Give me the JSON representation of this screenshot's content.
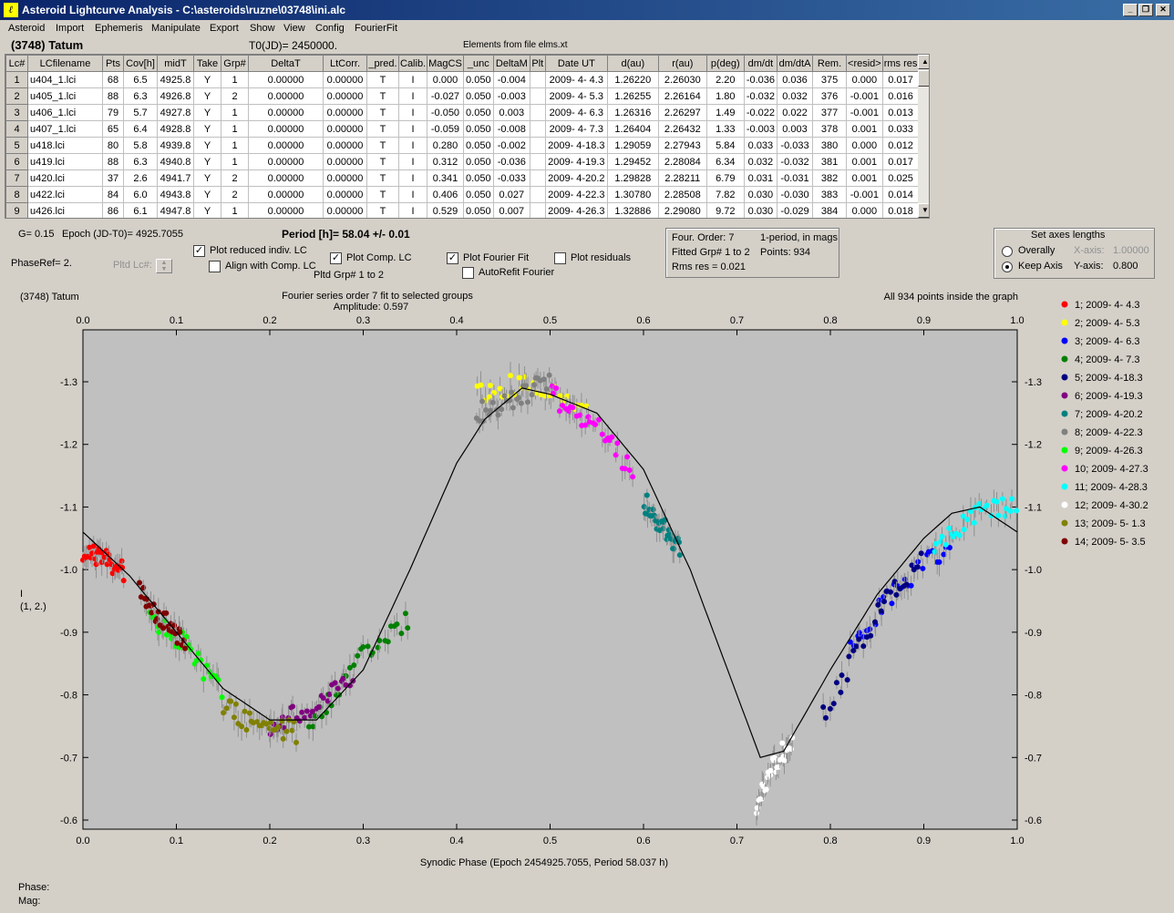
{
  "window": {
    "title": "Asteroid Lightcurve Analysis - C:\\asteroids\\ruzne\\03748\\ini.alc",
    "minimize": "_",
    "maximize": "❐",
    "close": "✕"
  },
  "menu": [
    "Asteroid",
    "Import",
    "Ephemeris",
    "Manipulate",
    "Export",
    "Show",
    "View",
    "Config",
    "FourierFit"
  ],
  "header": {
    "asteroid_name": "(3748) Tatum",
    "t0": "T0(JD)= 2450000.",
    "elements_source": "Elements from file elms.xt"
  },
  "table": {
    "columns": [
      "Lc#",
      "LCfilename",
      "Pts",
      "Cov[h]",
      "midT",
      "Take",
      "Grp#",
      "DeltaT",
      "LtCorr.",
      "_pred.",
      "Calib.",
      "MagCS",
      "_unc",
      "DeltaM",
      "Plt",
      "Date UT",
      "d(au)",
      "r(au)",
      "p(deg)",
      "dm/dt",
      "dm/dtA",
      "Rem.",
      "<resid>",
      "rms res"
    ],
    "rows": [
      [
        "1",
        "u404_1.lci",
        "68",
        "6.5",
        "4925.8",
        "Y",
        "1",
        "0.00000",
        "0.00000",
        "T",
        "I",
        "0.000",
        "0.050",
        "-0.004",
        "",
        "2009- 4- 4.3",
        "1.26220",
        "2.26030",
        "2.20",
        "-0.036",
        "0.036",
        "375",
        "0.000",
        "0.017"
      ],
      [
        "2",
        "u405_1.lci",
        "88",
        "6.3",
        "4926.8",
        "Y",
        "2",
        "0.00000",
        "0.00000",
        "T",
        "I",
        "-0.027",
        "0.050",
        "-0.003",
        "",
        "2009- 4- 5.3",
        "1.26255",
        "2.26164",
        "1.80",
        "-0.032",
        "0.032",
        "376",
        "-0.001",
        "0.016"
      ],
      [
        "3",
        "u406_1.lci",
        "79",
        "5.7",
        "4927.8",
        "Y",
        "1",
        "0.00000",
        "0.00000",
        "T",
        "I",
        "-0.050",
        "0.050",
        "0.003",
        "",
        "2009- 4- 6.3",
        "1.26316",
        "2.26297",
        "1.49",
        "-0.022",
        "0.022",
        "377",
        "-0.001",
        "0.013"
      ],
      [
        "4",
        "u407_1.lci",
        "65",
        "6.4",
        "4928.8",
        "Y",
        "1",
        "0.00000",
        "0.00000",
        "T",
        "I",
        "-0.059",
        "0.050",
        "-0.008",
        "",
        "2009- 4- 7.3",
        "1.26404",
        "2.26432",
        "1.33",
        "-0.003",
        "0.003",
        "378",
        "0.001",
        "0.033"
      ],
      [
        "5",
        "u418.lci",
        "80",
        "5.8",
        "4939.8",
        "Y",
        "1",
        "0.00000",
        "0.00000",
        "T",
        "I",
        "0.280",
        "0.050",
        "-0.002",
        "",
        "2009- 4-18.3",
        "1.29059",
        "2.27943",
        "5.84",
        "0.033",
        "-0.033",
        "380",
        "0.000",
        "0.012"
      ],
      [
        "6",
        "u419.lci",
        "88",
        "6.3",
        "4940.8",
        "Y",
        "1",
        "0.00000",
        "0.00000",
        "T",
        "I",
        "0.312",
        "0.050",
        "-0.036",
        "",
        "2009- 4-19.3",
        "1.29452",
        "2.28084",
        "6.34",
        "0.032",
        "-0.032",
        "381",
        "0.001",
        "0.017"
      ],
      [
        "7",
        "u420.lci",
        "37",
        "2.6",
        "4941.7",
        "Y",
        "2",
        "0.00000",
        "0.00000",
        "T",
        "I",
        "0.341",
        "0.050",
        "-0.033",
        "",
        "2009- 4-20.2",
        "1.29828",
        "2.28211",
        "6.79",
        "0.031",
        "-0.031",
        "382",
        "0.001",
        "0.025"
      ],
      [
        "8",
        "u422.lci",
        "84",
        "6.0",
        "4943.8",
        "Y",
        "2",
        "0.00000",
        "0.00000",
        "T",
        "I",
        "0.406",
        "0.050",
        "0.027",
        "",
        "2009- 4-22.3",
        "1.30780",
        "2.28508",
        "7.82",
        "0.030",
        "-0.030",
        "383",
        "-0.001",
        "0.014"
      ],
      [
        "9",
        "u426.lci",
        "86",
        "6.1",
        "4947.8",
        "Y",
        "1",
        "0.00000",
        "0.00000",
        "T",
        "I",
        "0.529",
        "0.050",
        "0.007",
        "",
        "2009- 4-26.3",
        "1.32886",
        "2.29080",
        "9.72",
        "0.030",
        "-0.029",
        "384",
        "0.000",
        "0.018"
      ]
    ]
  },
  "params": {
    "g": "G= 0.15",
    "epoch": "Epoch (JD-T0)= 4925.7055",
    "period": "Period [h]= 58.04 +/- 0.01",
    "phase_ref": "PhaseRef= 2.",
    "pltd_lc": "Pltd Lc#:",
    "pltd_grp": "Pltd Grp#  1  to   2"
  },
  "checkboxes": {
    "plot_reduced": {
      "label": "Plot reduced indiv. LC",
      "checked": true
    },
    "align_comp": {
      "label": "Align with Comp. LC",
      "checked": false
    },
    "plot_comp": {
      "label": "Plot Comp. LC",
      "checked": true
    },
    "plot_fourier": {
      "label": "Plot Fourier Fit",
      "checked": true
    },
    "autorefit": {
      "label": "AutoRefit Fourier",
      "checked": false
    },
    "plot_residuals": {
      "label": "Plot residuals",
      "checked": false
    }
  },
  "fourier_box": {
    "order": "Four. Order:  7",
    "mode": "1-period, in mags",
    "fitted": "Fitted Grp# 1 to 2",
    "points": "Points: 934",
    "rms": "Rms res      = 0.021"
  },
  "axes_box": {
    "title": "Set axes lengths",
    "overally": "Overally",
    "keep_axis": "Keep Axis",
    "selected": "Keep Axis",
    "xaxis_label": "X-axis:",
    "xaxis_value": "1.00000",
    "yaxis_label": "Y-axis:",
    "yaxis_value": "0.800"
  },
  "chart_data": {
    "type": "scatter",
    "title": "(3748) Tatum",
    "subtitle": "Fourier series order 7 fit to selected groups",
    "amplitude": "Amplitude: 0.597",
    "note": "All 934 points inside the graph",
    "xlabel": "Synodic Phase (Epoch 2454925.7055, Period 58.037 h)",
    "ylabel": "I",
    "ylabel2": "(1, 2.)",
    "xlim": [
      0.0,
      1.0
    ],
    "ylim": [
      -0.58,
      -1.38
    ],
    "y_inverted": true,
    "x_ticks": [
      "0.0",
      "0.1",
      "0.2",
      "0.3",
      "0.4",
      "0.5",
      "0.6",
      "0.7",
      "0.8",
      "0.9",
      "1.0"
    ],
    "y_ticks": [
      "-1.3",
      "-1.2",
      "-1.1",
      "-1.0",
      "-0.9",
      "-0.8",
      "-0.7",
      "-0.6"
    ],
    "legend_position": "right",
    "fit_curve": {
      "x": [
        0.0,
        0.05,
        0.1,
        0.15,
        0.2,
        0.25,
        0.3,
        0.35,
        0.4,
        0.43,
        0.47,
        0.5,
        0.55,
        0.6,
        0.65,
        0.7,
        0.725,
        0.75,
        0.8,
        0.85,
        0.9,
        0.93,
        0.96,
        1.0
      ],
      "y": [
        -1.06,
        -0.99,
        -0.9,
        -0.81,
        -0.76,
        -0.76,
        -0.84,
        -1.0,
        -1.17,
        -1.24,
        -1.29,
        -1.28,
        -1.25,
        -1.16,
        -1.0,
        -0.8,
        -0.7,
        -0.71,
        -0.84,
        -0.96,
        -1.05,
        -1.09,
        -1.1,
        -1.06
      ]
    },
    "series": [
      {
        "name": "1; 2009- 4- 4.3",
        "color": "#ff0000",
        "x_range": [
          0.0,
          0.045
        ],
        "y_points": [
          [
            0.0,
            -1.03
          ],
          [
            0.02,
            -1.02
          ],
          [
            0.04,
            -1.0
          ]
        ]
      },
      {
        "name": "2; 2009- 4- 5.3",
        "color": "#ffff00",
        "x_range": [
          0.42,
          0.54
        ],
        "y_points": [
          [
            0.42,
            -1.28
          ],
          [
            0.48,
            -1.3
          ],
          [
            0.54,
            -1.26
          ]
        ]
      },
      {
        "name": "3; 2009- 4- 6.3",
        "color": "#0000ff",
        "x_range": [
          0.82,
          0.93
        ],
        "y_points": [
          [
            0.82,
            -0.87
          ],
          [
            0.87,
            -0.97
          ],
          [
            0.93,
            -1.04
          ]
        ]
      },
      {
        "name": "4; 2009- 4- 7.3",
        "color": "#008000",
        "x_range": [
          0.24,
          0.35
        ],
        "y_points": [
          [
            0.24,
            -0.75
          ],
          [
            0.3,
            -0.86
          ],
          [
            0.35,
            -0.92
          ]
        ]
      },
      {
        "name": "5; 2009- 4-18.3",
        "color": "#000080",
        "x_range": [
          0.79,
          0.9
        ],
        "y_points": [
          [
            0.79,
            -0.76
          ],
          [
            0.85,
            -0.93
          ],
          [
            0.9,
            -1.03
          ]
        ]
      },
      {
        "name": "6; 2009- 4-19.3",
        "color": "#800080",
        "x_range": [
          0.2,
          0.29
        ],
        "y_points": [
          [
            0.2,
            -0.75
          ],
          [
            0.25,
            -0.78
          ],
          [
            0.29,
            -0.83
          ]
        ]
      },
      {
        "name": "7; 2009- 4-20.2",
        "color": "#008080",
        "x_range": [
          0.6,
          0.64
        ],
        "y_points": [
          [
            0.6,
            -1.11
          ],
          [
            0.62,
            -1.07
          ],
          [
            0.64,
            -1.03
          ]
        ]
      },
      {
        "name": "8; 2009- 4-22.3",
        "color": "#808080",
        "x_range": [
          0.42,
          0.5
        ],
        "y_points": [
          [
            0.42,
            -1.25
          ],
          [
            0.46,
            -1.27
          ],
          [
            0.5,
            -1.3
          ]
        ]
      },
      {
        "name": "9; 2009- 4-26.3",
        "color": "#00ff00",
        "x_range": [
          0.07,
          0.15
        ],
        "y_points": [
          [
            0.07,
            -0.93
          ],
          [
            0.11,
            -0.88
          ],
          [
            0.15,
            -0.8
          ]
        ]
      },
      {
        "name": "10; 2009- 4-27.3",
        "color": "#ff00ff",
        "x_range": [
          0.5,
          0.59
        ],
        "y_points": [
          [
            0.5,
            -1.28
          ],
          [
            0.55,
            -1.23
          ],
          [
            0.59,
            -1.15
          ]
        ]
      },
      {
        "name": "11; 2009- 4-28.3",
        "color": "#00ffff",
        "x_range": [
          0.91,
          1.0
        ],
        "y_points": [
          [
            0.91,
            -1.02
          ],
          [
            0.95,
            -1.09
          ],
          [
            1.0,
            -1.1
          ]
        ]
      },
      {
        "name": "12; 2009- 4-30.2",
        "color": "#ffffff",
        "x_range": [
          0.72,
          0.76
        ],
        "y_points": [
          [
            0.72,
            -0.62
          ],
          [
            0.74,
            -0.69
          ],
          [
            0.76,
            -0.73
          ]
        ]
      },
      {
        "name": "13; 2009- 5- 1.3",
        "color": "#808000",
        "x_range": [
          0.15,
          0.23
        ],
        "y_points": [
          [
            0.15,
            -0.78
          ],
          [
            0.19,
            -0.75
          ],
          [
            0.23,
            -0.74
          ]
        ]
      },
      {
        "name": "14; 2009- 5- 3.5",
        "color": "#800000",
        "x_range": [
          0.06,
          0.11
        ],
        "y_points": [
          [
            0.06,
            -0.97
          ],
          [
            0.085,
            -0.92
          ],
          [
            0.11,
            -0.88
          ]
        ]
      }
    ]
  },
  "status": {
    "phase": "Phase:",
    "mag": "Mag:"
  }
}
